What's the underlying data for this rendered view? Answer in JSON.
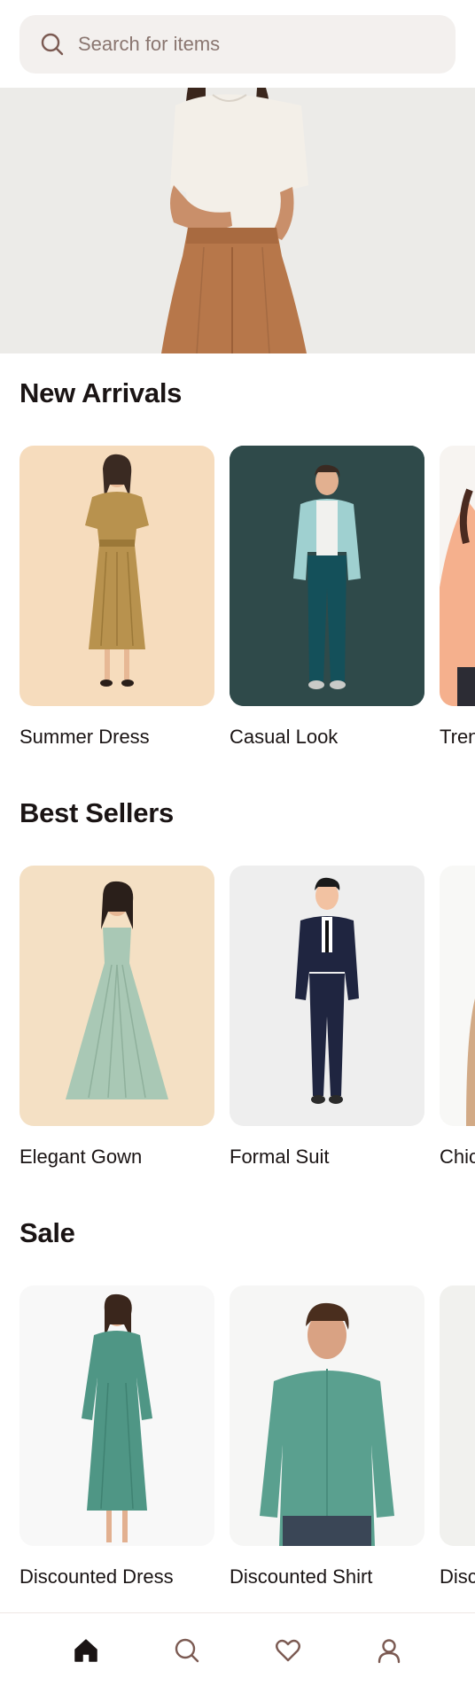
{
  "search": {
    "placeholder": "Search for items",
    "icon": "search-icon"
  },
  "hero": {
    "image": "woman-in-white-tee-and-tan-trousers"
  },
  "sections": [
    {
      "title": "New Arrivals",
      "items": [
        {
          "label": "Summer Dress",
          "bg": "#f6dcbd"
        },
        {
          "label": "Casual Look",
          "bg": "#2f4a4a"
        },
        {
          "label": "Trendy Outfit",
          "bg": "#f7f4f1"
        }
      ]
    },
    {
      "title": "Best Sellers",
      "items": [
        {
          "label": "Elegant Gown",
          "bg": "#f4e0c4"
        },
        {
          "label": "Formal Suit",
          "bg": "#eeeeee"
        },
        {
          "label": "Chic Style",
          "bg": "#f8f8f6"
        }
      ]
    },
    {
      "title": "Sale",
      "items": [
        {
          "label": "Discounted Dress",
          "bg": "#f8f8f8"
        },
        {
          "label": "Discounted Shirt",
          "bg": "#f6f6f5"
        },
        {
          "label": "Discounted Item",
          "bg": "#f1f1ee"
        }
      ]
    }
  ],
  "nav": [
    {
      "name": "home",
      "icon": "home-icon",
      "active": true
    },
    {
      "name": "search",
      "icon": "search-icon",
      "active": false
    },
    {
      "name": "favorites",
      "icon": "heart-icon",
      "active": false
    },
    {
      "name": "profile",
      "icon": "user-icon",
      "active": false
    }
  ],
  "colors": {
    "accent": "#5a3a34",
    "icon": "#7b5a52",
    "text": "#1a1414"
  }
}
